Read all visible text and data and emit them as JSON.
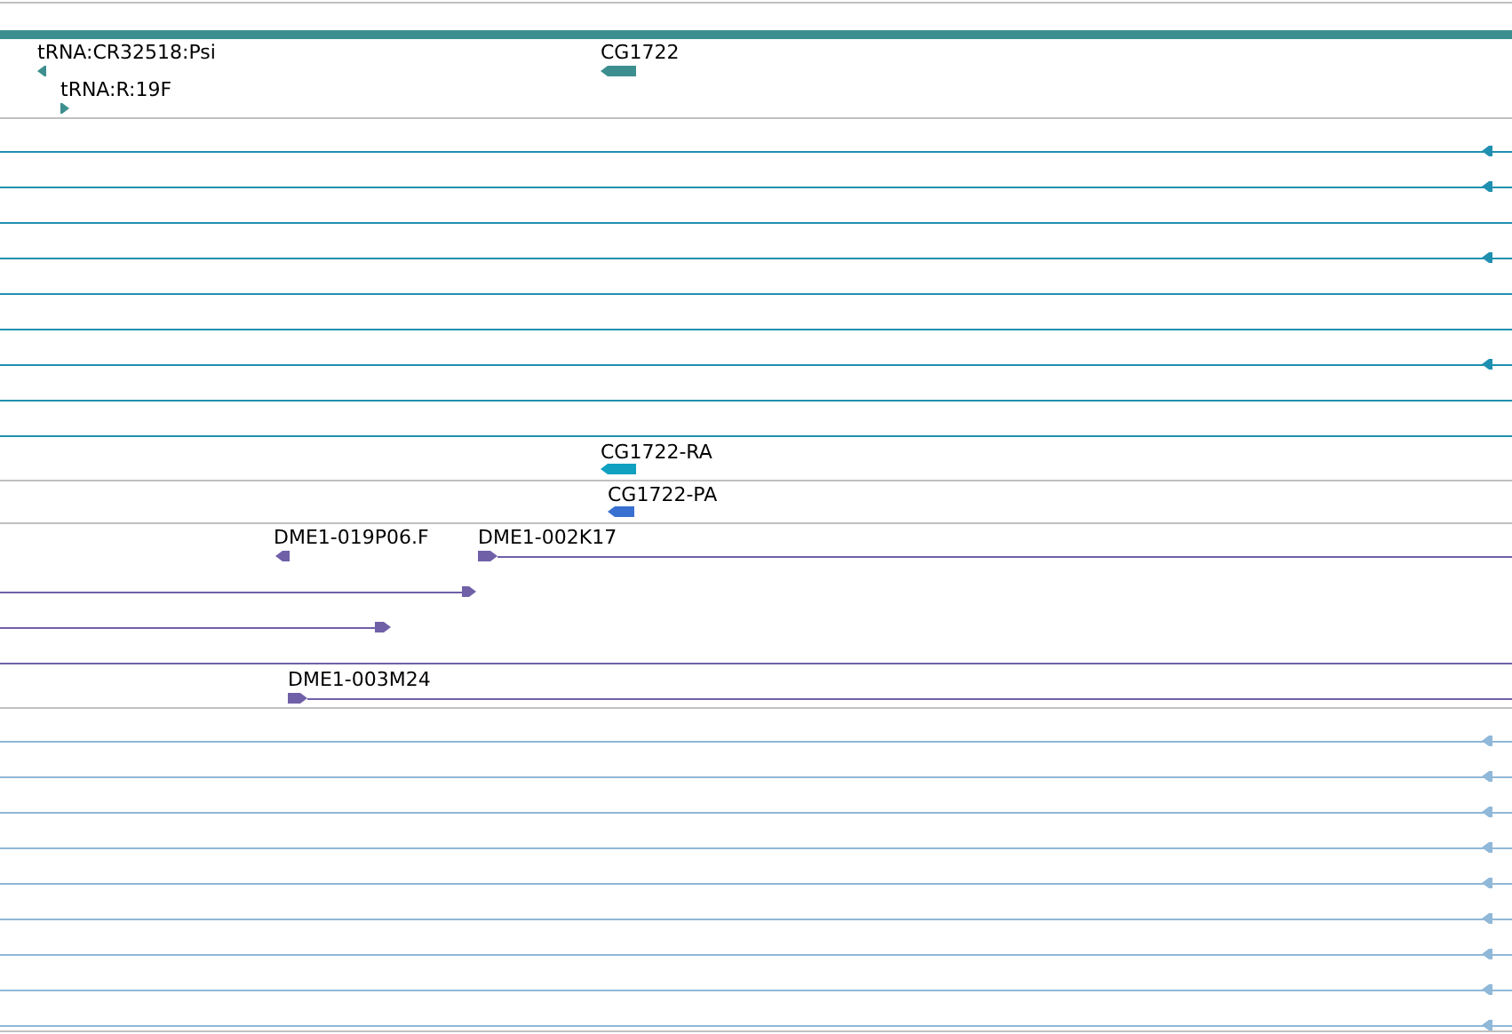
{
  "gene_track": {
    "features": [
      {
        "label": "tRNA:CR32518:Psi",
        "kind": "reverse"
      },
      {
        "label": "tRNA:R:19F",
        "kind": "forward"
      },
      {
        "label": "CG1722",
        "kind": "reverse"
      }
    ]
  },
  "alignment_rows": [
    {
      "continues_right": true
    },
    {
      "continues_right": true
    },
    {
      "continues_right": false
    },
    {
      "continues_right": true
    },
    {
      "continues_right": false
    },
    {
      "continues_right": false
    },
    {
      "continues_right": true
    },
    {
      "continues_right": false
    },
    {
      "continues_right": false
    }
  ],
  "transcripts": [
    {
      "label": "CG1722-RA",
      "kind": "reverse",
      "color": "#10a0c0"
    },
    {
      "label": "CG1722-PA",
      "kind": "reverse",
      "color": "#3a70d0"
    }
  ],
  "clones": [
    {
      "label": "DME1-019P06.F",
      "kind": "reverse"
    },
    {
      "label": "DME1-002K17",
      "kind": "forward"
    },
    {
      "label": "DME1-003M24",
      "kind": "forward"
    }
  ],
  "lower_rows": [
    {
      "continues_right": true
    },
    {
      "continues_right": true
    },
    {
      "continues_right": true
    },
    {
      "continues_right": true
    },
    {
      "continues_right": true
    },
    {
      "continues_right": true
    },
    {
      "continues_right": true
    },
    {
      "continues_right": true
    },
    {
      "continues_right": true
    }
  ]
}
